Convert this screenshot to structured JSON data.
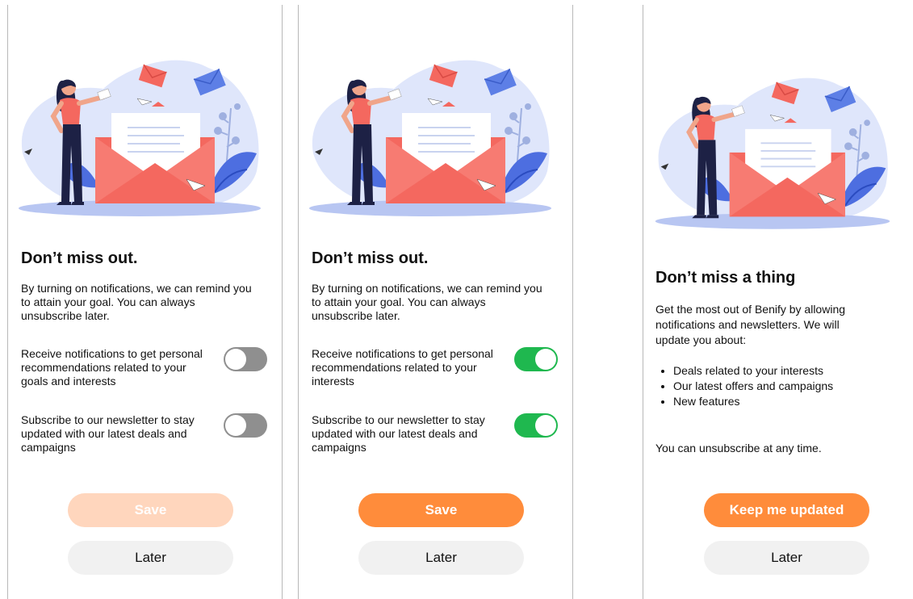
{
  "panels": [
    {
      "title": "Don’t miss out.",
      "description": "By turning on notifications, we can remind you to attain your goal. You can always unsubscribe later.",
      "toggles": [
        {
          "label": "Receive notifications to get personal recommendations related to your goals and interests",
          "state": "off"
        },
        {
          "label": "Subscribe to our newsletter to stay updated with our latest deals and campaigns",
          "state": "off"
        }
      ],
      "primary_button": "Save",
      "primary_state": "disabled",
      "secondary_button": "Later"
    },
    {
      "title": "Don’t miss out.",
      "description": "By turning on notifications, we can remind you to attain your goal. You can always unsubscribe later.",
      "toggles": [
        {
          "label": "Receive notifications to get personal recommendations related to your interests",
          "state": "on"
        },
        {
          "label": "Subscribe to our newsletter to stay updated with our latest deals and campaigns",
          "state": "on"
        }
      ],
      "primary_button": "Save",
      "primary_state": "enabled",
      "secondary_button": "Later"
    },
    {
      "title": "Don’t miss a thing",
      "description": "Get the most out of Benify by allowing notifications and newsletters. We will update you about:",
      "bullets": [
        "Deals related to your interests",
        "Our latest offers and campaigns",
        "New features"
      ],
      "footer": "You can unsubscribe at any time.",
      "primary_button": "Keep me updated",
      "primary_state": "enabled",
      "secondary_button": "Later"
    }
  ],
  "colors": {
    "accent_orange": "#ff8c3b",
    "accent_orange_disabled": "#ffd6bd",
    "toggle_on": "#1fb84f",
    "toggle_off": "#8f8f8f",
    "secondary_button_bg": "#f1f1f1",
    "envelope": "#f4685f",
    "blob": "#dfe6fb"
  },
  "icons": {
    "illustration": "woman-with-envelope-illustration"
  }
}
